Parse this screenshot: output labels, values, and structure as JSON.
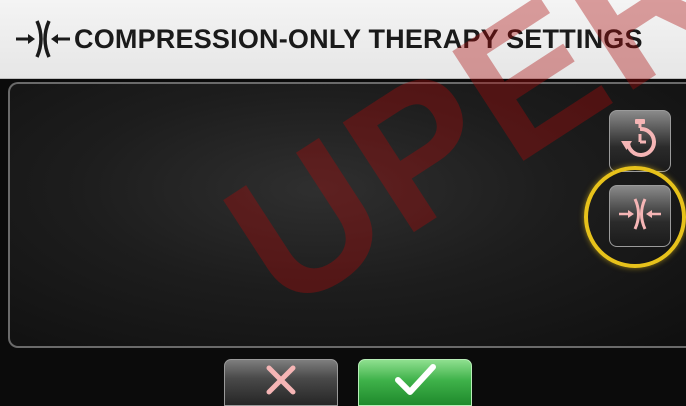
{
  "header": {
    "title": "COMPRESSION-ONLY THERAPY SETTINGS",
    "icon": "compression-arrows-icon"
  },
  "side_buttons": [
    {
      "name": "timer",
      "icon": "stopwatch-restart-icon"
    },
    {
      "name": "compression-only",
      "icon": "compression-arrows-icon",
      "highlighted": true
    }
  ],
  "bottom_buttons": {
    "cancel_icon": "x-icon",
    "confirm_icon": "check-icon"
  },
  "watermark": {
    "text": "UPER"
  },
  "colors": {
    "title_bar": "#eeeeee",
    "highlight_ring": "#e7c21b",
    "confirm_green": "#3fb24a",
    "icon_pink": "#f5b5b5",
    "watermark_red": "#aa0a0a"
  }
}
